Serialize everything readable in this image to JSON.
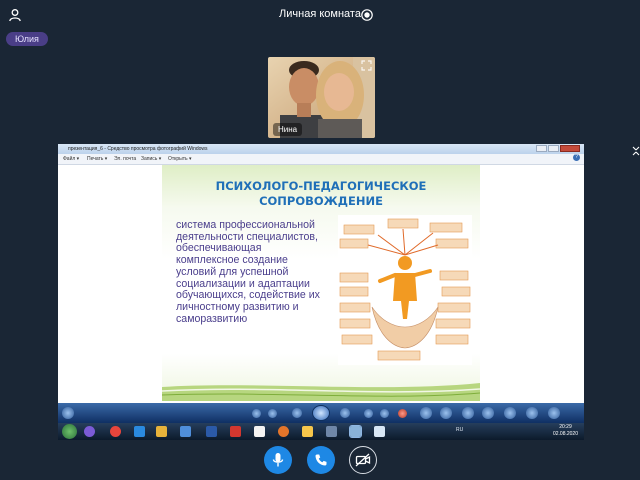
{
  "header": {
    "room_title": "Личная комната"
  },
  "participants": [
    {
      "name": "Юлия"
    }
  ],
  "camera": {
    "name": "Нина"
  },
  "screen_share": {
    "window_title": "презентация_6 - Средство просмотра фотографий Windows",
    "menu": [
      "Файл ▾",
      "Печать ▾",
      "Эл. почта",
      "Запись ▾",
      "Открыть ▾"
    ],
    "slide": {
      "title_line1": "ПСИХОЛОГО-ПЕДАГОГИЧЕСКОЕ",
      "title_line2": "СОПРОВОЖДЕНИЕ",
      "body": "система профессиональной деятельности специалистов, обеспечивающая комплексное создание условий для успешной социализации и адаптации обучающихся, содействие их личностному развитию и саморазвитию"
    },
    "taskbar": {
      "lang": "RU",
      "time": "20:29",
      "date": "02.08.2020"
    }
  },
  "colors": {
    "background": "#1a2635",
    "accent": "#1e88e5",
    "participant_pill": "#4a3e87",
    "slide_title": "#1f6fb8",
    "slide_text": "#4a3e8c"
  },
  "icons": {
    "user": "user-icon",
    "record": "record-icon",
    "expand": "expand-icon",
    "mic": "microphone-icon",
    "phone": "phone-icon",
    "camera_off": "camera-off-icon"
  }
}
